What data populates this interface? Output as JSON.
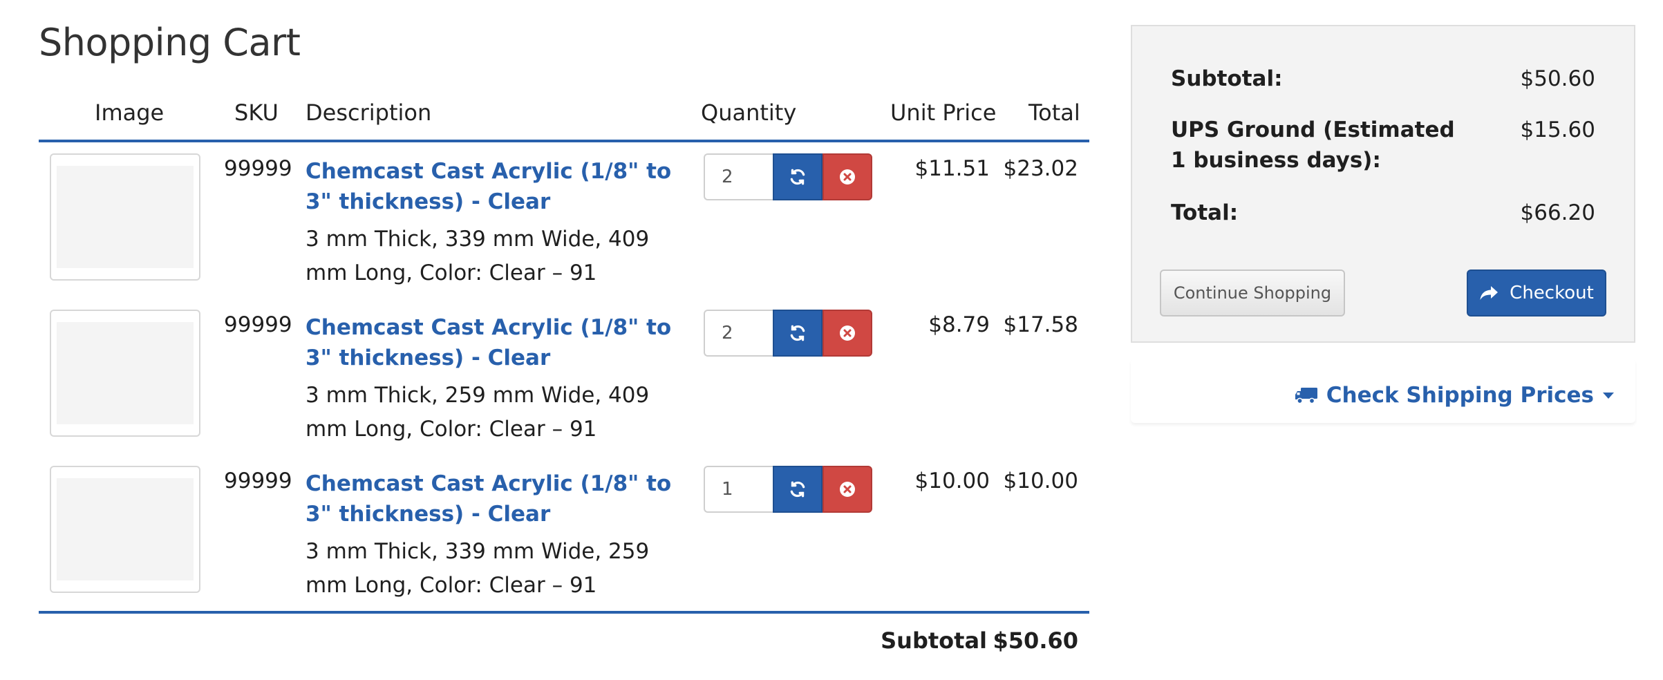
{
  "page": {
    "title": "Shopping Cart"
  },
  "table": {
    "headers": {
      "image": "Image",
      "sku": "SKU",
      "description": "Description",
      "quantity": "Quantity",
      "unit_price": "Unit Price",
      "total": "Total"
    },
    "rows": [
      {
        "sku": "99999",
        "title": "Chemcast Cast Acrylic (1/8\" to 3\" thickness) - Clear",
        "options": "3 mm Thick, 339 mm Wide, 409 mm Long, Color: Clear – 91",
        "quantity": "2",
        "unit_price": "$11.51",
        "total": "$23.02"
      },
      {
        "sku": "99999",
        "title": "Chemcast Cast Acrylic (1/8\" to 3\" thickness) - Clear",
        "options": "3 mm Thick, 259 mm Wide, 409 mm Long, Color: Clear – 91",
        "quantity": "2",
        "unit_price": "$8.79",
        "total": "$17.58"
      },
      {
        "sku": "99999",
        "title": "Chemcast Cast Acrylic (1/8\" to 3\" thickness) - Clear",
        "options": "3 mm Thick, 339 mm Wide, 259 mm Long, Color: Clear – 91",
        "quantity": "1",
        "unit_price": "$10.00",
        "total": "$10.00"
      }
    ],
    "footer": {
      "subtotal_label": "Subtotal",
      "subtotal_value": "$50.60"
    }
  },
  "summary": {
    "subtotal_label": "Subtotal:",
    "subtotal_value": "$50.60",
    "shipping_label": "UPS Ground (Estimated 1 business days):",
    "shipping_value": "$15.60",
    "total_label": "Total:",
    "total_value": "$66.20",
    "continue_label": "Continue Shopping",
    "checkout_label": "Checkout"
  },
  "shipping": {
    "link_label": "Check Shipping Prices"
  },
  "icons": {
    "refresh": "refresh-icon",
    "remove": "remove-circle-icon",
    "checkout": "share-arrow-icon",
    "truck": "truck-icon",
    "caret": "caret-down-icon"
  },
  "colors": {
    "primary": "#2860ac",
    "danger": "#d04843",
    "panel_bg": "#f3f3f3"
  }
}
